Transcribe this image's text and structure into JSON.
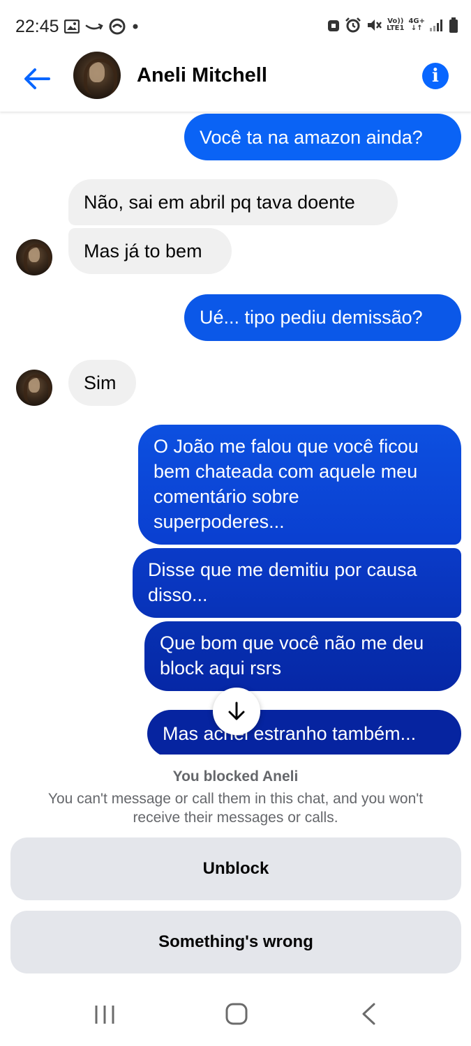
{
  "status_bar": {
    "time": "22:45",
    "left_icons": [
      "gallery-icon",
      "amazon-icon",
      "edge-icon",
      "dot-icon"
    ],
    "right_icons": [
      "sim-lock-icon",
      "alarm-icon",
      "mute-icon",
      "volte-icon",
      "4g-icon",
      "signal-icon",
      "battery-icon"
    ],
    "volte_label": "Vo))",
    "lte_label": "LTE1",
    "network_label": "4G+"
  },
  "header": {
    "contact_name": "Aneli Mitchell",
    "back_icon": "arrow-left-icon",
    "info_icon": "info-icon",
    "accent_color": "#0866ff"
  },
  "messages": [
    {
      "direction": "out",
      "text": "Você ta na amazon ainda?"
    },
    {
      "direction": "in",
      "text": "Não, sai em abril pq tava doente"
    },
    {
      "direction": "in",
      "text": "Mas já to bem"
    },
    {
      "direction": "out",
      "text": "Ué... tipo pediu demissão?"
    },
    {
      "direction": "in",
      "text": "Sim"
    },
    {
      "direction": "out",
      "lines": [
        "O João me falou que você ficou",
        "bem chateada com aquele meu",
        "comentário sobre",
        "superpoderes..."
      ]
    },
    {
      "direction": "out",
      "lines": [
        "Disse que me demitiu por causa",
        "disso..."
      ]
    },
    {
      "direction": "out",
      "lines": [
        "Que bom que você não me deu",
        "block aqui rsrs"
      ]
    },
    {
      "direction": "out",
      "text": "Mas achei estranho também..."
    }
  ],
  "blocked": {
    "title": "You blocked Aneli",
    "description_line1": "You can't message or call them in this chat, and you won't",
    "description_line2": "receive their messages or calls.",
    "unblock_label": "Unblock",
    "something_wrong_label": "Something's wrong"
  },
  "nav": {
    "icons": [
      "recent-apps-icon",
      "home-icon",
      "back-icon"
    ]
  }
}
